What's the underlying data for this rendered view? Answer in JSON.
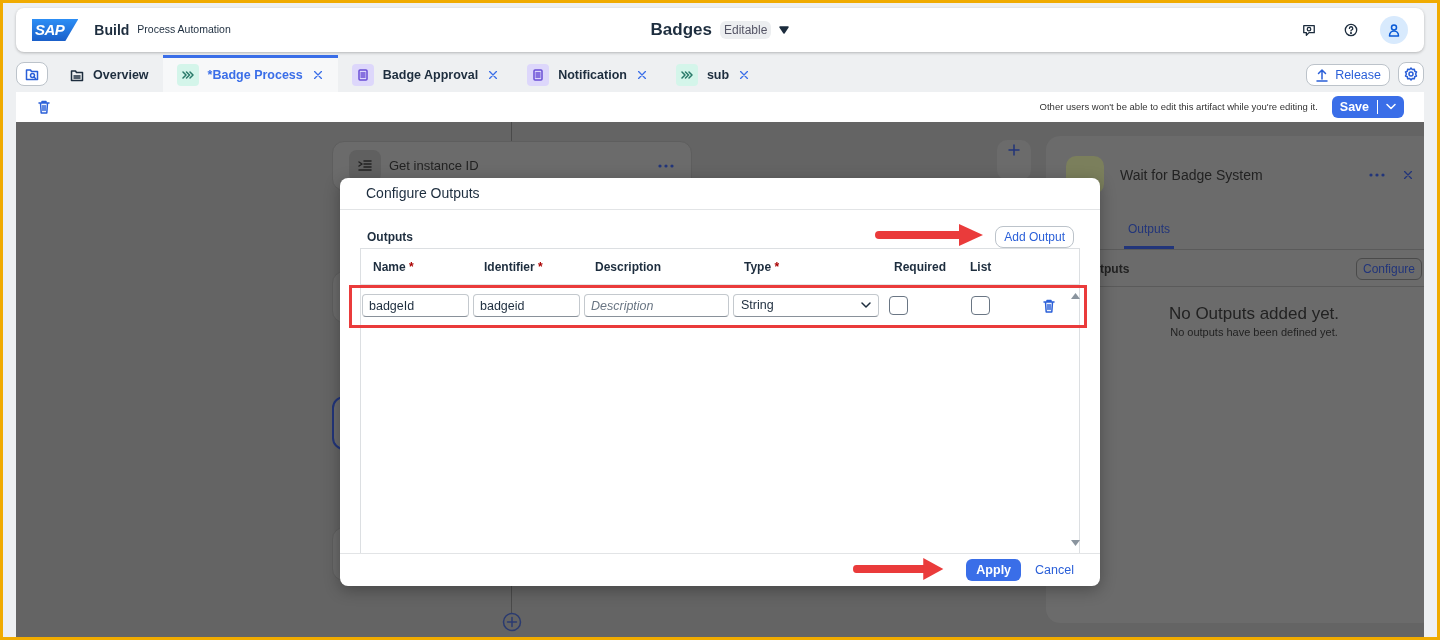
{
  "header": {
    "logo": "SAP",
    "product": "Build",
    "subtitle": "Process Automation",
    "title": "Badges",
    "status": "Editable"
  },
  "tabs": [
    {
      "label": "Overview",
      "kind": "overview",
      "selected": false,
      "closable": false
    },
    {
      "label": "*Badge Process",
      "kind": "process",
      "selected": true,
      "closable": true
    },
    {
      "label": "Badge Approval",
      "kind": "form",
      "selected": false,
      "closable": true
    },
    {
      "label": "Notification",
      "kind": "form",
      "selected": false,
      "closable": true
    },
    {
      "label": "sub",
      "kind": "process",
      "selected": false,
      "closable": true
    }
  ],
  "actions": {
    "release": "Release"
  },
  "toolbar": {
    "notice": "Other users won't be able to edit this artifact while you're editing it.",
    "save": "Save"
  },
  "canvas": {
    "nodes": [
      {
        "label": "Get instance ID",
        "kind": "task"
      },
      {
        "kind": "stub"
      },
      {
        "kind": "stub-selected"
      },
      {
        "kind": "stub"
      }
    ]
  },
  "side_panel": {
    "title": "Wait for Badge System",
    "tabs": [
      {
        "label": "Outputs",
        "selected": true
      }
    ],
    "section": "tputs",
    "configure": "Configure",
    "empty_title": "No Outputs added yet.",
    "empty_text": "No outputs have been defined yet."
  },
  "dialog": {
    "title": "Configure Outputs",
    "section": "Outputs",
    "add_button": "Add Output",
    "columns": [
      {
        "label": "Name",
        "required_mark": "*"
      },
      {
        "label": "Identifier",
        "required_mark": "*"
      },
      {
        "label": "Description"
      },
      {
        "label": "Type",
        "required_mark": "*"
      },
      {
        "label": "Required"
      },
      {
        "label": "List"
      }
    ],
    "rows": [
      {
        "name": "badgeId",
        "identifier": "badgeid",
        "description": {
          "placeholder": "Description"
        },
        "type": "String",
        "required": false,
        "list": false
      }
    ],
    "apply": "Apply",
    "cancel": "Cancel"
  }
}
